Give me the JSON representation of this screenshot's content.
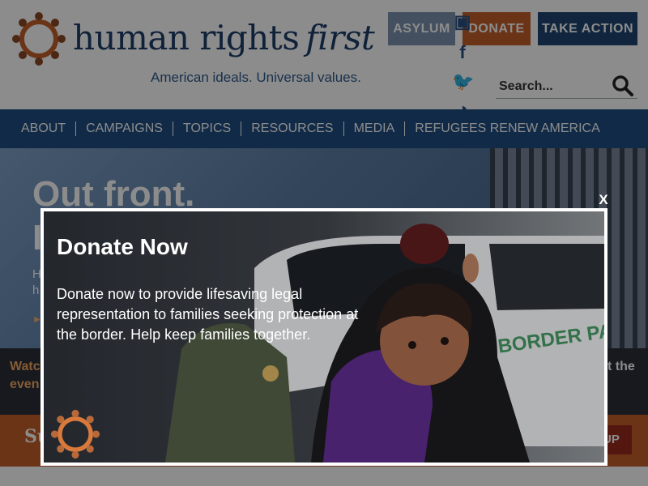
{
  "header": {
    "logo_text_main": "human rights",
    "logo_text_italic": "first",
    "tagline": "American ideals. Universal values.",
    "buttons": {
      "asylum": "ASYLUM",
      "donate": "DONATE",
      "take_action": "TAKE ACTION"
    },
    "social": [
      {
        "icon": "youtube-icon",
        "glyph": "▣"
      },
      {
        "icon": "facebook-icon",
        "glyph": "f"
      },
      {
        "icon": "twitter-icon",
        "glyph": "🐦"
      },
      {
        "icon": "rss-icon",
        "glyph": "◔"
      }
    ],
    "search": {
      "placeholder": "Search..."
    }
  },
  "nav": {
    "items": [
      {
        "label": "ABOUT"
      },
      {
        "label": "CAMPAIGNS"
      },
      {
        "label": "TOPICS"
      },
      {
        "label": "RESOURCES"
      },
      {
        "label": "MEDIA"
      },
      {
        "label": "REFUGEES RENEW AMERICA"
      }
    ]
  },
  "hero": {
    "title_line1": "Out front.",
    "title_line2": "I",
    "text": "H\nh",
    "more": "►"
  },
  "watch": {
    "left_text": "Watc\neven",
    "right_text": "t the"
  },
  "signup": {
    "text": "Su",
    "button": "UP"
  },
  "modal": {
    "title": "Donate Now",
    "body": "Donate now to provide lifesaving legal representation to families seeking protection at the border. Help keep families together.",
    "close": "X",
    "vehicle_text": "BORDER PATR"
  },
  "colors": {
    "brand_navy": "#1e3f69",
    "brand_orange": "#c4602b",
    "nav_blue": "#1f4e82",
    "asylum_gray_blue": "#7d93b0"
  }
}
